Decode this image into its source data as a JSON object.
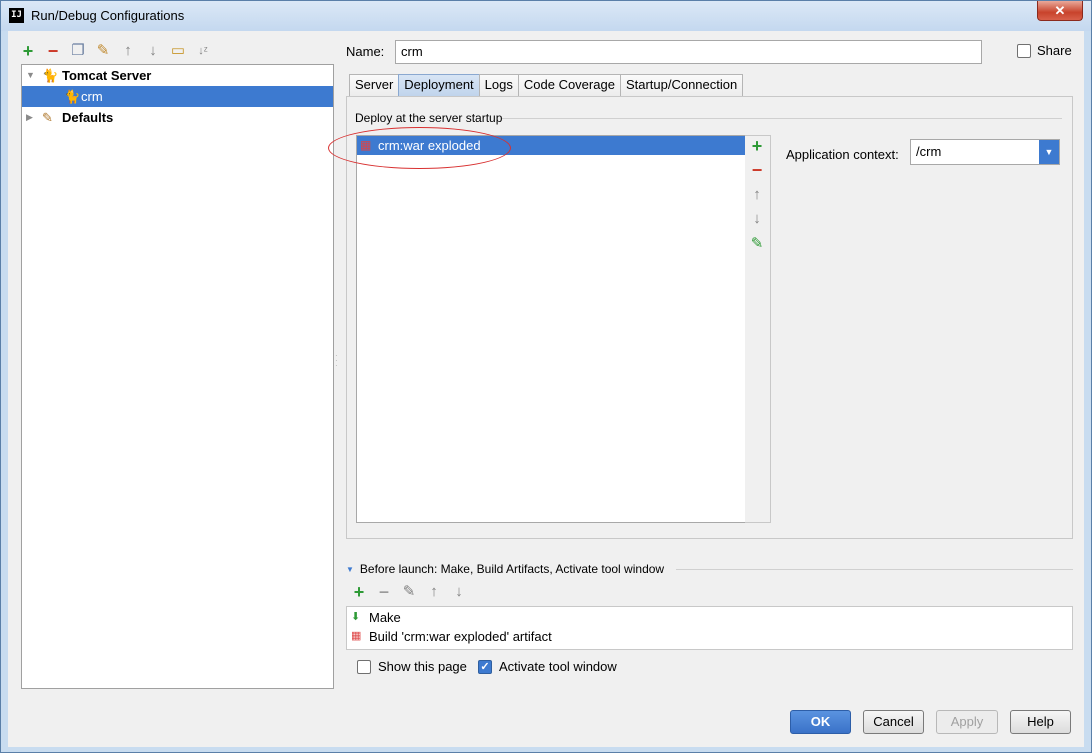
{
  "window": {
    "title": "Run/Debug Configurations",
    "app_icon": "IJ",
    "close_label": "✕"
  },
  "left_toolbar": {
    "icons": [
      "add-icon",
      "remove-icon",
      "copy-icon",
      "wrench-icon",
      "move-up-icon",
      "move-down-icon",
      "folder-icon",
      "sort-icon"
    ]
  },
  "tree": {
    "items": [
      {
        "label": "Tomcat Server",
        "expanded": true,
        "bold": true,
        "icon": "tomcat-icon"
      },
      {
        "label": "crm",
        "selected": true,
        "icon": "tomcat-config-icon"
      },
      {
        "label": "Defaults",
        "expanded": false,
        "bold": true,
        "icon": "wrench-icon"
      }
    ]
  },
  "name": {
    "label": "Name:",
    "value": "crm"
  },
  "share": {
    "label": "Share",
    "checked": false
  },
  "tabs": [
    "Server",
    "Deployment",
    "Logs",
    "Code Coverage",
    "Startup/Connection"
  ],
  "active_tab": "Deployment",
  "deployment": {
    "group_title": "Deploy at the server startup",
    "artifacts": [
      {
        "label": "crm:war exploded",
        "selected": true
      }
    ],
    "side_tools": [
      "add-icon",
      "remove-icon",
      "move-up-icon",
      "move-down-icon",
      "edit-icon"
    ],
    "app_context_label": "Application context:",
    "app_context_value": "/crm"
  },
  "before_launch": {
    "title": "Before launch: Make, Build Artifacts, Activate tool window",
    "toolbar": [
      "add-icon",
      "remove-icon",
      "edit-icon",
      "move-up-icon",
      "move-down-icon"
    ],
    "tasks": [
      {
        "label": "Make",
        "icon": "make-icon"
      },
      {
        "label": "Build 'crm:war exploded' artifact",
        "icon": "artifact-icon"
      }
    ]
  },
  "options": {
    "show_page": {
      "label": "Show this page",
      "checked": false
    },
    "activate_tool": {
      "label": "Activate tool window",
      "checked": true
    }
  },
  "buttons": {
    "ok": "OK",
    "cancel": "Cancel",
    "apply": "Apply",
    "help": "Help"
  },
  "colors": {
    "selection": "#3d7ad0",
    "annotation_circle": "#d83030",
    "add_green": "#2e9a36",
    "remove_red": "#cc3a2a"
  }
}
